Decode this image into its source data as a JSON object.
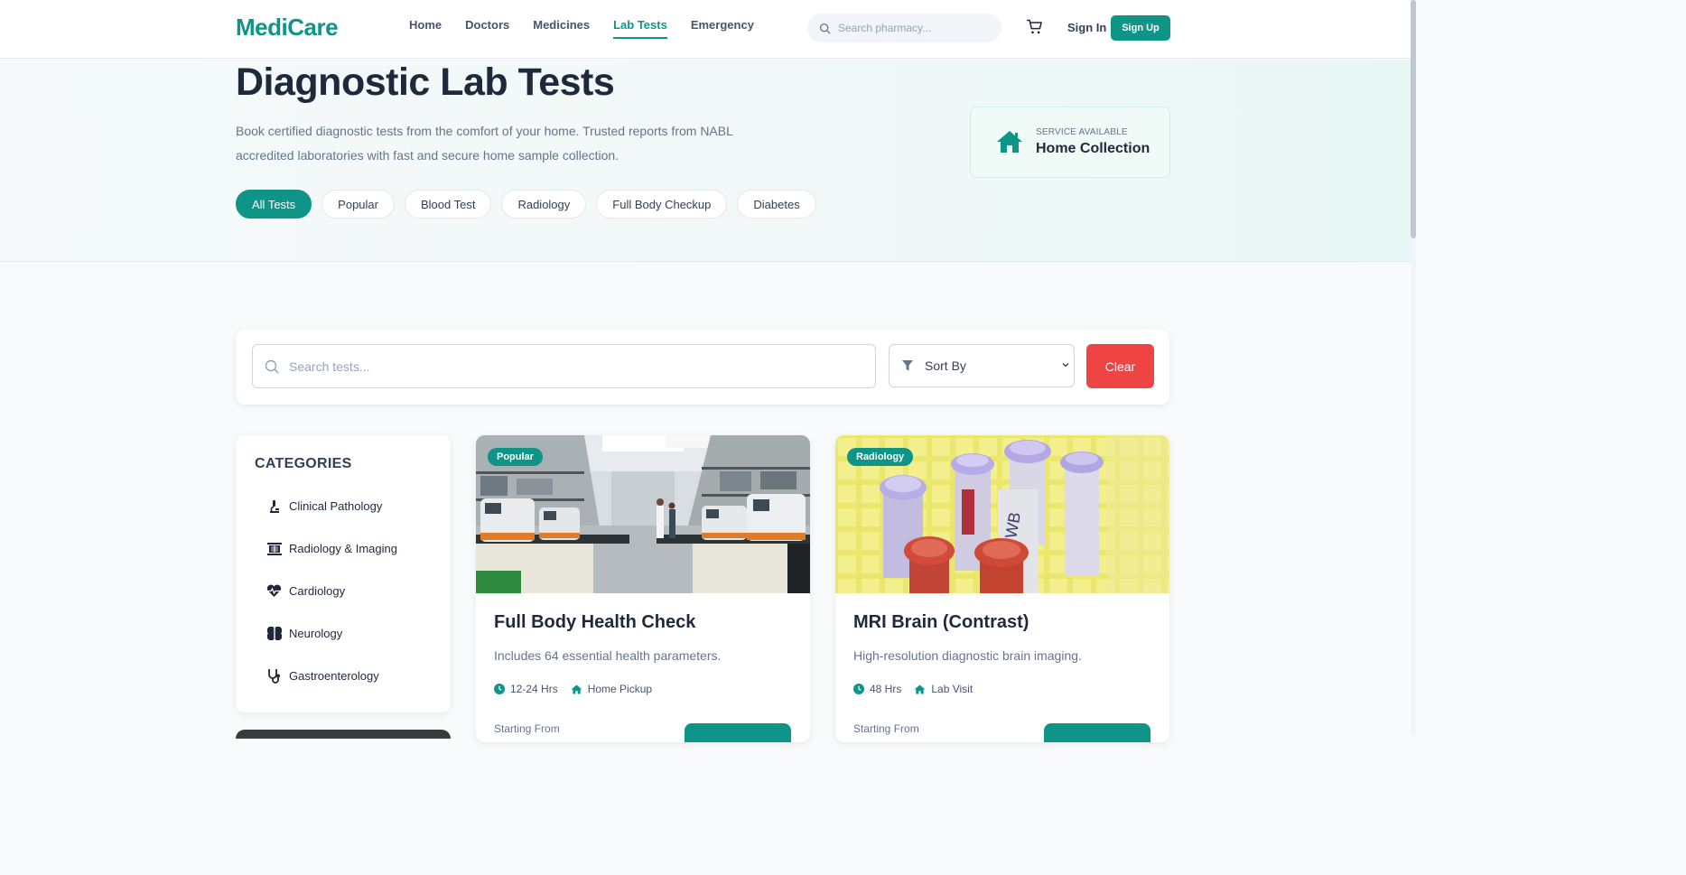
{
  "brand": {
    "logo": "MediCare",
    "accent": "#0f9488",
    "danger": "#ef4444"
  },
  "nav": {
    "links": [
      {
        "label": "Home"
      },
      {
        "label": "Doctors"
      },
      {
        "label": "Medicines"
      },
      {
        "label": "Lab Tests",
        "active": true
      },
      {
        "label": "Emergency"
      }
    ],
    "search_placeholder": "Search pharmacy...",
    "signin": "Sign In",
    "signup": "Sign Up"
  },
  "hero": {
    "title": "Diagnostic Lab Tests",
    "description": "Book certified diagnostic tests from the comfort of your home. Trusted reports from NABL accredited laboratories with fast and secure home sample collection.",
    "pills": [
      "All Tests",
      "Popular",
      "Blood Test",
      "Radiology",
      "Full Body Checkup",
      "Diabetes"
    ],
    "service": {
      "small": "SERVICE AVAILABLE",
      "big": "Home Collection"
    }
  },
  "filter": {
    "search_placeholder": "Search tests...",
    "sort_label": "Sort By",
    "clear": "Clear"
  },
  "sidebar": {
    "title": "CATEGORIES",
    "items": [
      {
        "label": "Clinical Pathology",
        "icon": "microscope-icon"
      },
      {
        "label": "Radiology & Imaging",
        "icon": "x-ray-icon"
      },
      {
        "label": "Cardiology",
        "icon": "heart-pulse-icon"
      },
      {
        "label": "Neurology",
        "icon": "brain-icon"
      },
      {
        "label": "Gastroenterology",
        "icon": "stethoscope-icon"
      }
    ]
  },
  "cards": [
    {
      "badge": "Popular",
      "title": "Full Body Health Check",
      "desc": "Includes 64 essential health parameters.",
      "time": "12-24 Hrs",
      "mode": "Home Pickup",
      "from": "Starting From",
      "image": "laboratory-photo"
    },
    {
      "badge": "Radiology",
      "title": "MRI Brain (Contrast)",
      "desc": "High-resolution diagnostic brain imaging.",
      "time": "48 Hrs",
      "mode": "Lab Visit",
      "from": "Starting From",
      "image": "test-tubes-photo"
    }
  ]
}
